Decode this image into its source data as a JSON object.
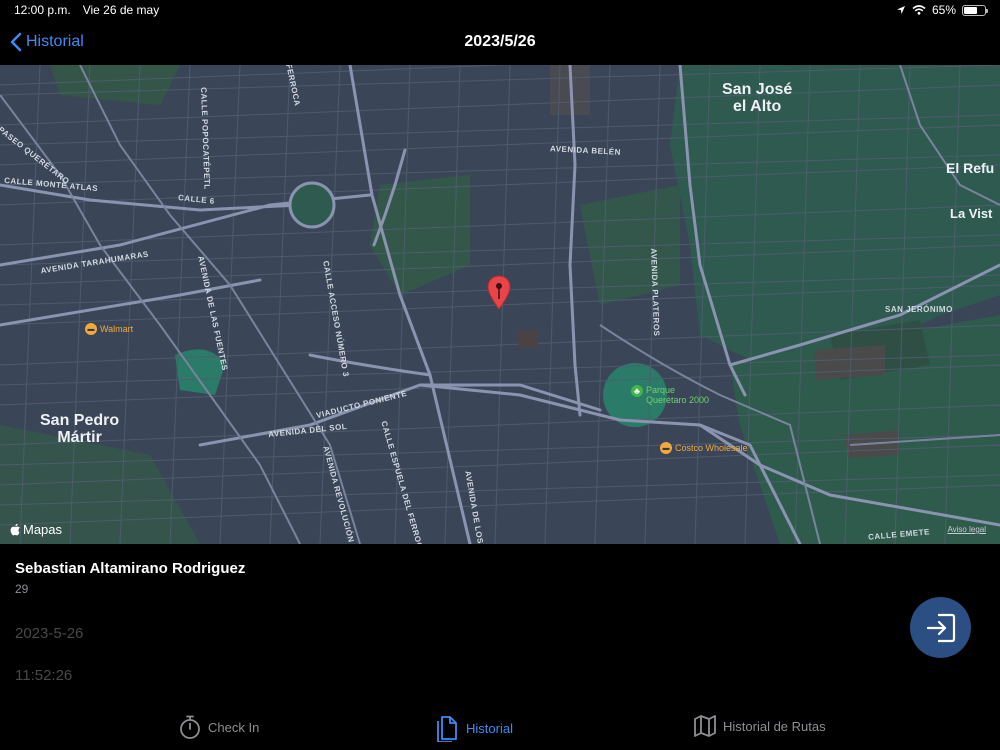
{
  "status_bar": {
    "time": "12:00 p.m.",
    "date": "Vie 26 de may",
    "battery": "65%",
    "battery_level": 0.65
  },
  "nav": {
    "back_label": "Historial",
    "title": "2023/5/26"
  },
  "map": {
    "attribution": "Mapas",
    "legal": "Aviso legal",
    "cities": [
      "San José\nel Alto",
      "San Pedro\nMártir",
      "El Refu",
      "La Vist"
    ],
    "streets": [
      "PASEO QUERÉTARO",
      "CALLE POPOCATÉPETL",
      "CALLE MONTE ATLAS",
      "CALLE 6",
      "AVENIDA TARAHUMARAS",
      "AVENIDA DE LAS FUENTES",
      "CALLE ACCESO NÚMERO 3",
      "AVENIDA BELÉN",
      "AVENIDA PLATEROS",
      "SAN JERÓNIMO",
      "VIADUCTO PONIENTE",
      "AVENIDA DEL SOL",
      "AVENIDA REVOLUCIÓN",
      "CALLE ESPUELA DEL FERROCA",
      "AVENIDA DE LOS",
      "CALLE EMETE",
      "FERROCA"
    ],
    "pois": [
      "Walmart",
      "Costco Wholesale"
    ],
    "park": "Parque\nQuerétaro 2000"
  },
  "record": {
    "name": "Sebastian Altamirano Rodriguez",
    "number": "29",
    "date": "2023-5-26",
    "time": "11:52:26"
  },
  "tabs": [
    {
      "label": "Check In",
      "icon": "stopwatch-icon",
      "active": false
    },
    {
      "label": "Historial",
      "icon": "document-icon",
      "active": true
    },
    {
      "label": "Historial de Rutas",
      "icon": "map-icon",
      "active": false
    }
  ],
  "colors": {
    "accent": "#3b8cf5",
    "fab": "#2c4f83",
    "pin": "#e8444a",
    "map_base": "#3a4658",
    "map_green": "#2e5a50"
  }
}
